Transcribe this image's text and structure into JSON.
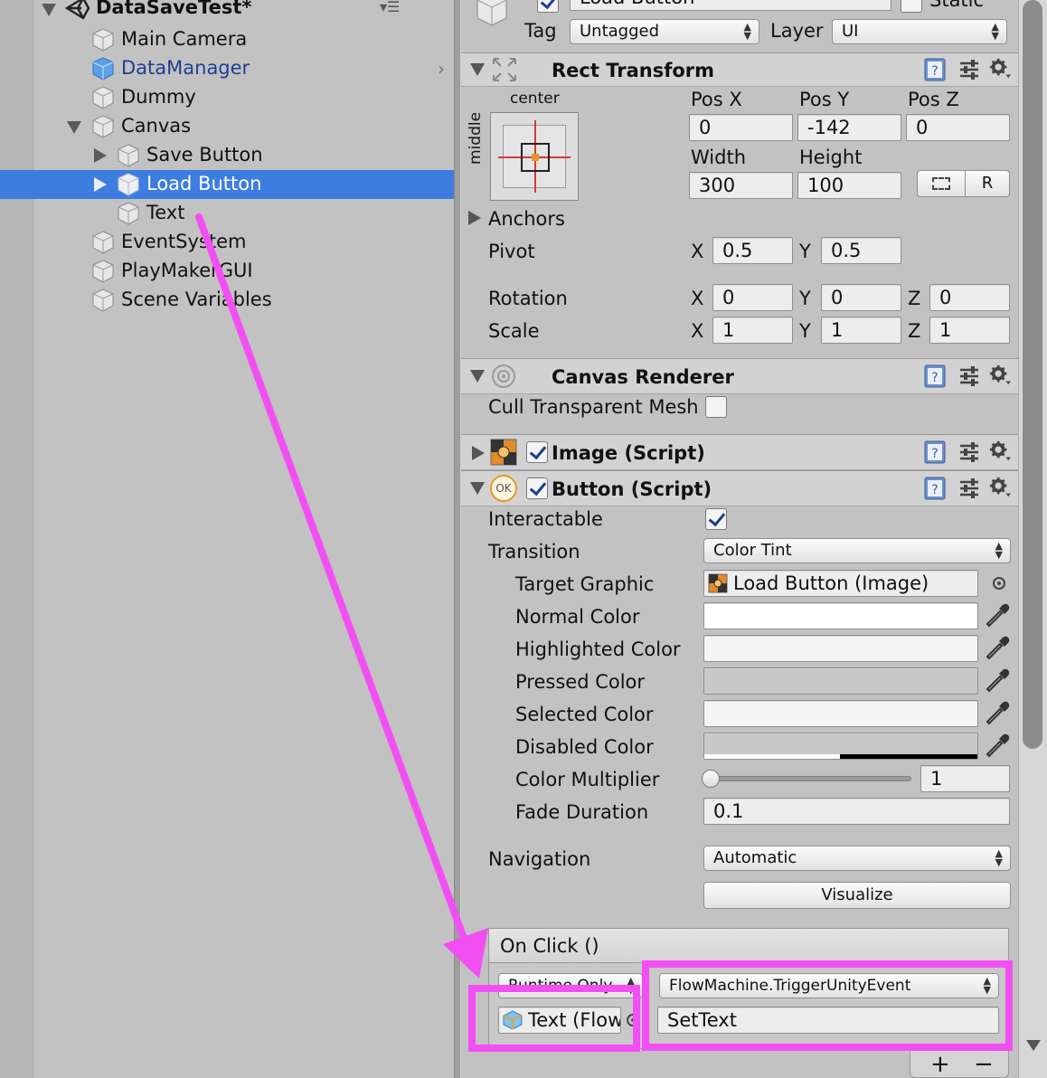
{
  "hierarchy": {
    "root": "DataSaveTest*",
    "items": [
      {
        "label": "Main Camera"
      },
      {
        "label": "DataManager"
      },
      {
        "label": "Dummy"
      },
      {
        "label": "Canvas"
      },
      {
        "label": "Save Button"
      },
      {
        "label": "Load Button"
      },
      {
        "label": "Text"
      },
      {
        "label": "EventSystem"
      },
      {
        "label": "PlayMakerGUI"
      },
      {
        "label": "Scene Variables"
      }
    ]
  },
  "header": {
    "name_value": "Load Button",
    "static_label": "Static",
    "tag_label": "Tag",
    "tag_value": "Untagged",
    "layer_label": "Layer",
    "layer_value": "UI"
  },
  "rect_transform": {
    "title": "Rect Transform",
    "anchor_h": "center",
    "anchor_v": "middle",
    "pos_x_label": "Pos X",
    "pos_y_label": "Pos Y",
    "pos_z_label": "Pos Z",
    "pos_x": "0",
    "pos_y": "-142",
    "pos_z": "0",
    "width_label": "Width",
    "height_label": "Height",
    "width": "300",
    "height": "100",
    "r_button": "R",
    "anchors_label": "Anchors",
    "pivot_label": "Pivot",
    "pivot_x": "0.5",
    "pivot_y": "0.5",
    "rotation_label": "Rotation",
    "rot_x": "0",
    "rot_y": "0",
    "rot_z": "0",
    "scale_label": "Scale",
    "scale_x": "1",
    "scale_y": "1",
    "scale_z": "1",
    "axis_x": "X",
    "axis_y": "Y",
    "axis_z": "Z"
  },
  "canvas_renderer": {
    "title": "Canvas Renderer",
    "cull_label": "Cull Transparent Mesh"
  },
  "image_script": {
    "title": "Image (Script)"
  },
  "button_script": {
    "title": "Button (Script)",
    "icon_text": "OK",
    "interactable_label": "Interactable",
    "transition_label": "Transition",
    "transition_value": "Color Tint",
    "target_graphic_label": "Target Graphic",
    "target_graphic_value": "Load Button (Image)",
    "normal_color_label": "Normal Color",
    "highlighted_color_label": "Highlighted Color",
    "pressed_color_label": "Pressed Color",
    "selected_color_label": "Selected Color",
    "disabled_color_label": "Disabled Color",
    "color_multiplier_label": "Color Multiplier",
    "color_multiplier_value": "1",
    "fade_duration_label": "Fade Duration",
    "fade_duration_value": "0.1",
    "navigation_label": "Navigation",
    "navigation_value": "Automatic",
    "visualize_label": "Visualize"
  },
  "on_click": {
    "title": "On Click ()",
    "runtime_value": "Runtime Only",
    "function_value": "FlowMachine.TriggerUnityEvent",
    "object_value": "Text (Flow",
    "argument_value": "SetText",
    "plus": "+",
    "minus": "−"
  },
  "colors": {
    "selection": "#3e7de0",
    "highlight": "#f24ff2",
    "panel": "#c2c2c2",
    "prefab_text": "#1f3f93"
  }
}
